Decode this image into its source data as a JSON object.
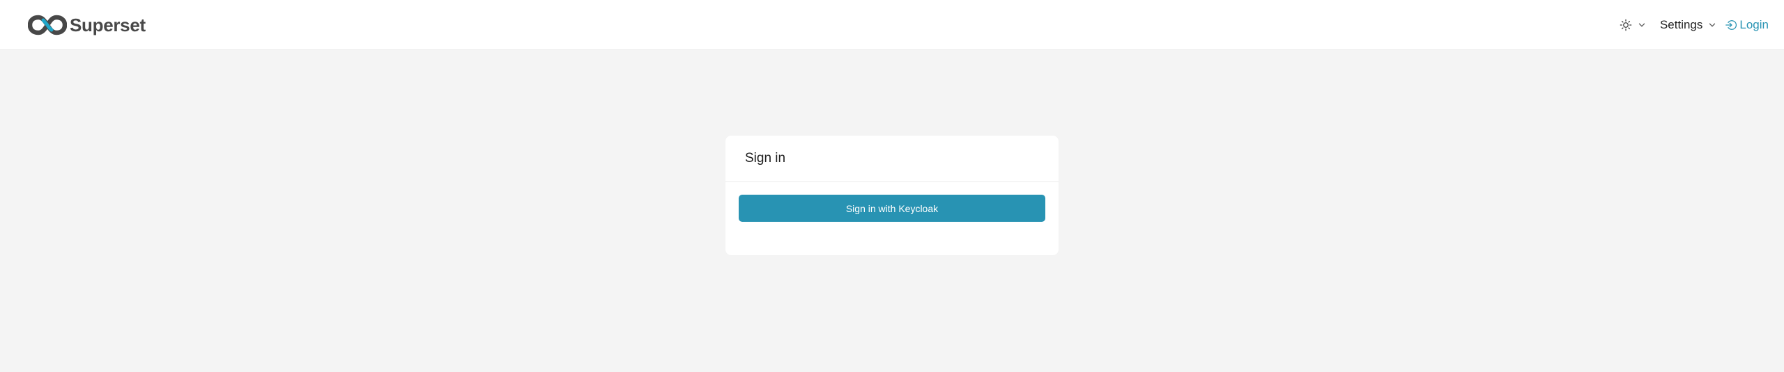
{
  "navbar": {
    "brand_name": "Superset",
    "brand_color": "#484848",
    "logo_colors": [
      "#484848",
      "#20a7c9"
    ],
    "theme_icon": "sun-icon",
    "settings_label": "Settings",
    "login_label": "Login",
    "login_icon": "login-icon",
    "link_color": "#2893b3"
  },
  "card": {
    "title": "Sign in",
    "button_label": "Sign in with Keycloak",
    "button_color": "#2893b3"
  },
  "page": {
    "background": "#f4f4f4"
  }
}
